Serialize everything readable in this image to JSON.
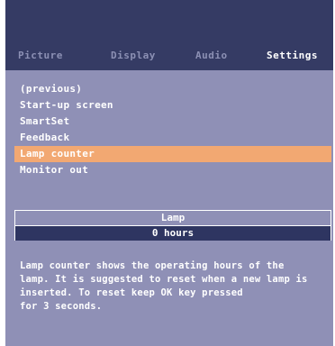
{
  "tabs": [
    {
      "label": "Picture",
      "active": false
    },
    {
      "label": "Display",
      "active": false
    },
    {
      "label": "Audio",
      "active": false
    },
    {
      "label": "Settings",
      "active": true
    }
  ],
  "menu": {
    "items": [
      {
        "label": "(previous)"
      },
      {
        "label": "Start-up screen"
      },
      {
        "label": "SmartSet"
      },
      {
        "label": "Feedback"
      },
      {
        "label": "Lamp counter",
        "selected": true
      },
      {
        "label": "Monitor out"
      }
    ]
  },
  "lamp": {
    "title": "Lamp",
    "value": "0 hours"
  },
  "help": {
    "lines": [
      "Lamp counter shows the operating hours of the",
      "lamp. It is suggested to reset when a new lamp is",
      "inserted. To reset keep OK key pressed",
      "for 3 seconds."
    ]
  },
  "colors": {
    "header": "#353b64",
    "background": "#8f90b6",
    "selection": "#f2a872",
    "value_bar": "#2e3561"
  }
}
